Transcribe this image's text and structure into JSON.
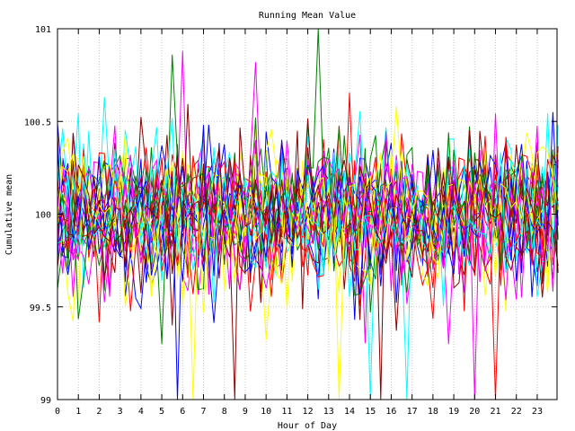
{
  "chart_data": {
    "type": "line",
    "title": "Running Mean Value",
    "xlabel": "Hour of Day",
    "ylabel": "Cumulative mean",
    "xlim": [
      0,
      23.95
    ],
    "ylim": [
      99,
      101
    ],
    "x_ticks": [
      "0",
      "1",
      "2",
      "3",
      "4",
      "5",
      "6",
      "7",
      "8",
      "9",
      "10",
      "11",
      "12",
      "13",
      "14",
      "15",
      "16",
      "17",
      "18",
      "19",
      "20",
      "21",
      "22",
      "23"
    ],
    "y_ticks": [
      {
        "value": 99,
        "label": "99"
      },
      {
        "value": 99.5,
        "label": "99.5"
      },
      {
        "value": 100,
        "label": "100"
      },
      {
        "value": 100.5,
        "label": "100.5"
      },
      {
        "value": 101,
        "label": "101"
      }
    ],
    "grid": true,
    "legend": "none",
    "series_colors": [
      "#ff0000",
      "#008000",
      "#0000ff",
      "#ff00ff",
      "#00ffff",
      "#ffff00",
      "#8b0000"
    ],
    "series_count": 28,
    "samples_per_hour": 4,
    "center": 100.0,
    "typical_spread": 0.25,
    "notable_excursions": [
      {
        "hour": 12.4,
        "value": 101.0
      },
      {
        "hour": 8.6,
        "value": 99.0
      },
      {
        "hour": 9.5,
        "value": 99.0
      },
      {
        "hour": 13.6,
        "value": 99.0
      },
      {
        "hour": 15.0,
        "value": 99.0
      },
      {
        "hour": 15.4,
        "value": 99.0
      },
      {
        "hour": 16.8,
        "value": 99.0
      },
      {
        "hour": 19.9,
        "value": 99.0
      },
      {
        "hour": 21.0,
        "value": 99.0
      },
      {
        "hour": 5.8,
        "value": 99.0
      },
      {
        "hour": 6.5,
        "value": 99.0
      },
      {
        "hour": 5.5,
        "value": 100.86
      },
      {
        "hour": 6.0,
        "value": 100.88
      },
      {
        "hour": 9.5,
        "value": 100.82
      }
    ]
  }
}
